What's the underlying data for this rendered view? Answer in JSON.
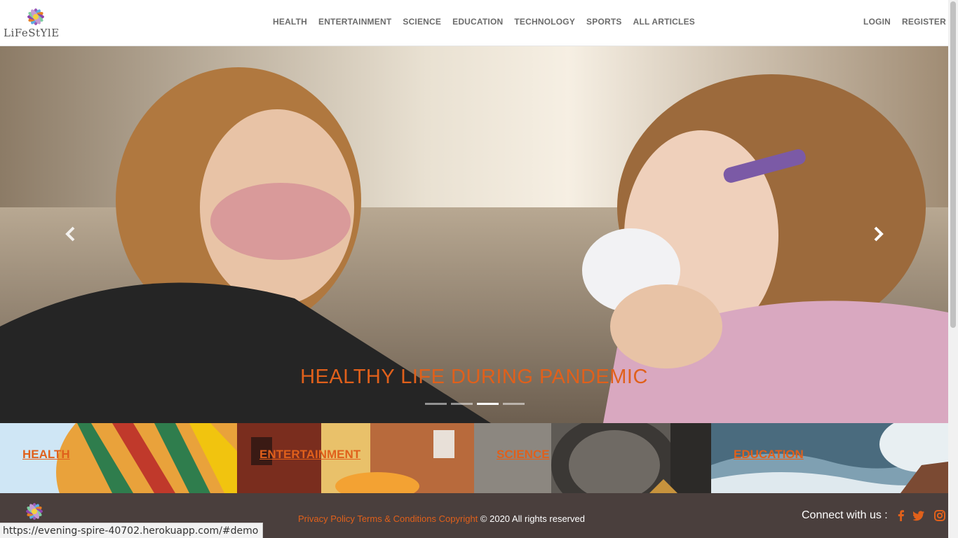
{
  "brand": {
    "logo_text": "LiFeStYlE"
  },
  "nav": {
    "items": [
      {
        "label": "HEALTH"
      },
      {
        "label": "ENTERTAINMENT"
      },
      {
        "label": "SCIENCE"
      },
      {
        "label": "EDUCATION"
      },
      {
        "label": "TECHNOLOGY"
      },
      {
        "label": "SPORTS"
      },
      {
        "label": "ALL ARTICLES"
      }
    ],
    "login_label": "LOGIN",
    "register_label": "REGISTER"
  },
  "carousel": {
    "caption": "HEALTHY LIFE DURING PANDEMIC",
    "slide_count": 4,
    "active_slide": 3,
    "prev_icon": "chevron-left-icon",
    "next_icon": "chevron-right-icon"
  },
  "categories": [
    {
      "label": "HEALTH"
    },
    {
      "label": "ENTERTAINMENT"
    },
    {
      "label": "SCIENCE"
    },
    {
      "label": "EDUCATION"
    }
  ],
  "footer": {
    "privacy_label": "Privacy Policy",
    "terms_label": "Terms & Conditions",
    "copyright_label": "Copyright",
    "rights_text": "© 2020 All rights reserved",
    "connect_text": "Connect with us :",
    "social_icons": [
      "facebook-icon",
      "twitter-icon",
      "instagram-icon"
    ]
  },
  "status_bar": {
    "url": "https://evening-spire-40702.herokuapp.com/#demo"
  },
  "colors": {
    "accent": "#e0601b",
    "footer_bg": "#4a3f3d",
    "nav_text": "#6b6b6b"
  }
}
